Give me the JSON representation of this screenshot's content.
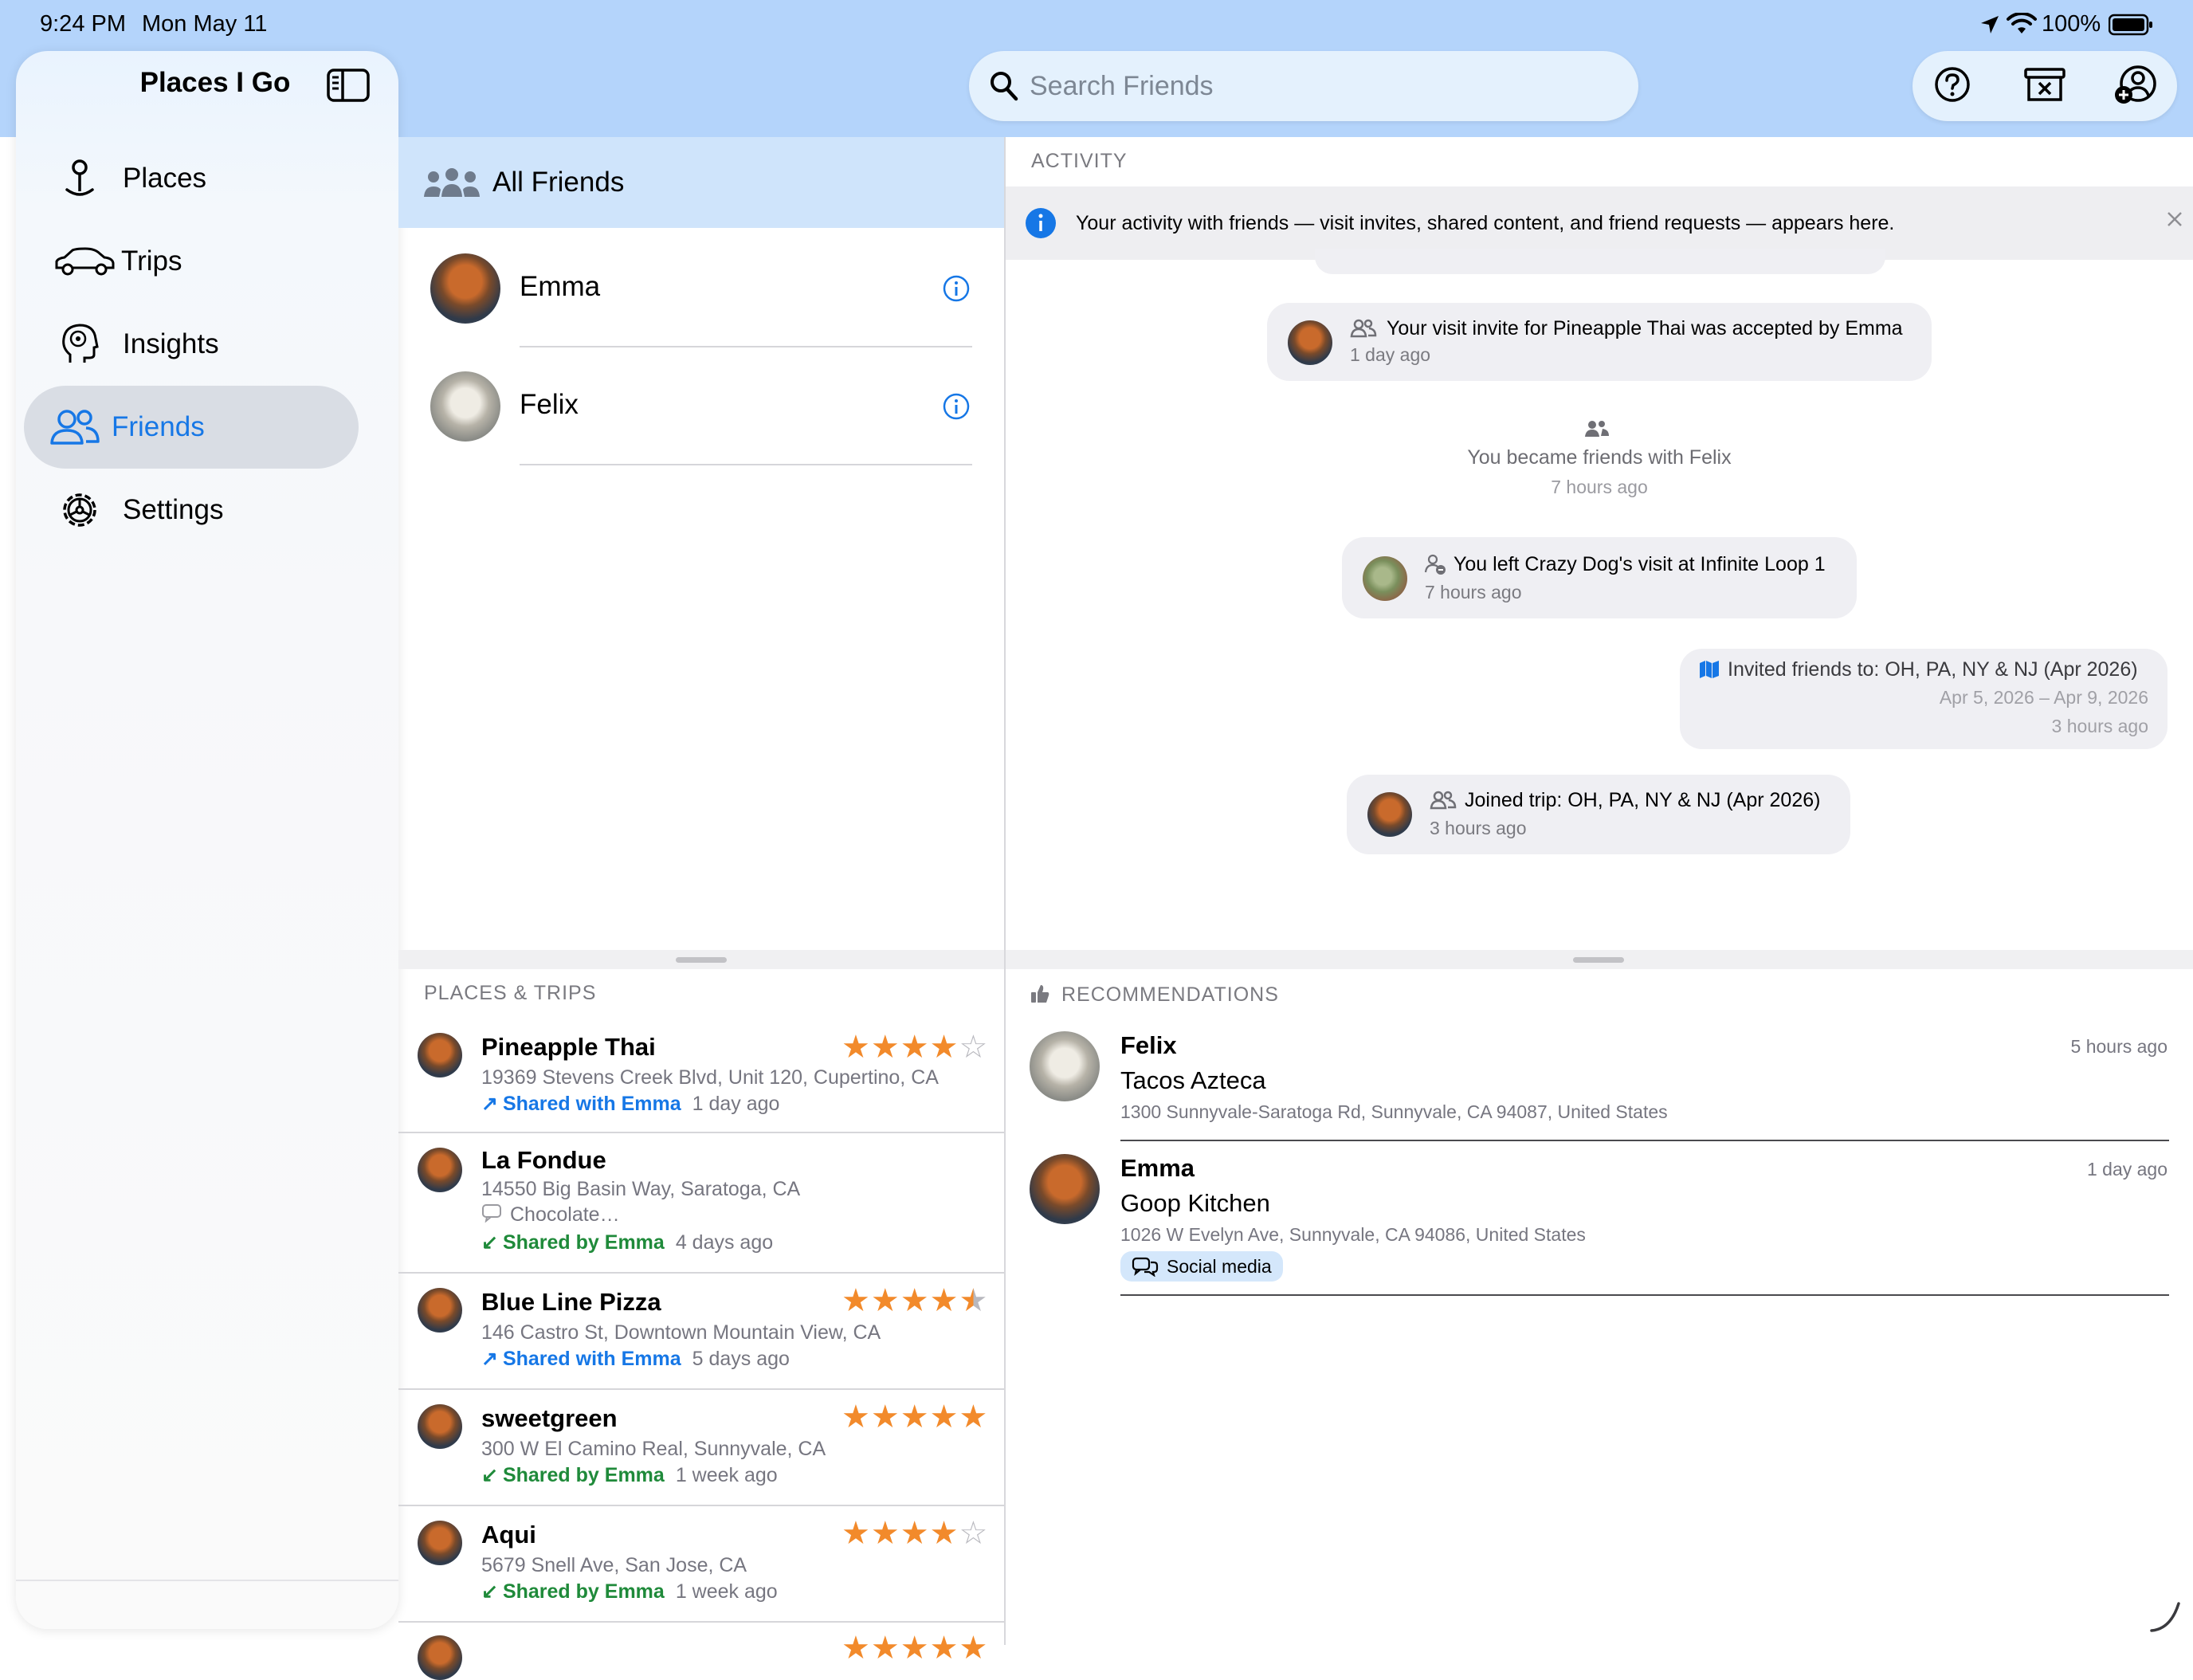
{
  "status_bar": {
    "time": "9:24 PM",
    "date": "Mon May 11",
    "battery": "100%"
  },
  "sidebar": {
    "title": "Places I Go",
    "items": [
      {
        "label": "Places",
        "icon": "pin-icon"
      },
      {
        "label": "Trips",
        "icon": "car-icon"
      },
      {
        "label": "Insights",
        "icon": "brain-head-icon"
      },
      {
        "label": "Friends",
        "icon": "people-icon",
        "selected": true
      },
      {
        "label": "Settings",
        "icon": "gear-icon"
      }
    ]
  },
  "search": {
    "placeholder": "Search Friends"
  },
  "toolbar": {
    "icons": [
      "help-icon",
      "archive-icon",
      "add-friend-icon"
    ]
  },
  "friends": {
    "header": "All Friends",
    "list": [
      {
        "name": "Emma"
      },
      {
        "name": "Felix"
      }
    ]
  },
  "activity": {
    "title": "ACTIVITY",
    "info": "Your activity with friends — visit invites, shared content, and friend requests — appears here.",
    "items": [
      {
        "text": "Your visit invite for Pineapple Thai was accepted by Emma",
        "time": "1 day ago"
      },
      {
        "text": "You became friends with Felix",
        "time": "7 hours ago"
      },
      {
        "text": "You left Crazy Dog's visit at Infinite Loop 1",
        "time": "7 hours ago"
      },
      {
        "text": "Invited friends to: OH, PA, NY & NJ (Apr 2026)",
        "dates": "Apr 5, 2026 – Apr 9, 2026",
        "time": "3 hours ago"
      },
      {
        "text": "Joined trip: OH, PA, NY & NJ (Apr 2026)",
        "time": "3 hours ago"
      }
    ]
  },
  "places_trips": {
    "title": "PLACES & TRIPS",
    "items": [
      {
        "name": "Pineapple Thai",
        "address": "19369 Stevens Creek Blvd, Unit 120, Cupertino, CA",
        "share": "Shared with Emma",
        "direction": "out",
        "time": "1 day ago",
        "rating": 4
      },
      {
        "name": "La Fondue",
        "address": "14550 Big Basin Way, Saratoga, CA",
        "note": "Chocolate…",
        "share": "Shared by Emma",
        "direction": "in",
        "time": "4 days ago",
        "rating": null
      },
      {
        "name": "Blue Line Pizza",
        "address": "146 Castro St, Downtown Mountain View, CA",
        "share": "Shared with Emma",
        "direction": "out",
        "time": "5 days ago",
        "rating": 4.5
      },
      {
        "name": "sweetgreen",
        "address": "300 W El Camino Real, Sunnyvale, CA",
        "share": "Shared by Emma",
        "direction": "in",
        "time": "1 week ago",
        "rating": 5
      },
      {
        "name": "Aqui",
        "address": "5679 Snell Ave, San Jose, CA",
        "share": "Shared by Emma",
        "direction": "in",
        "time": "1 week ago",
        "rating": 4
      }
    ]
  },
  "recommendations": {
    "title": "RECOMMENDATIONS",
    "items": [
      {
        "friend": "Felix",
        "place": "Tacos Azteca",
        "address": "1300 Sunnyvale-Saratoga Rd, Sunnyvale, CA  94087, United States",
        "time": "5 hours ago"
      },
      {
        "friend": "Emma",
        "place": "Goop Kitchen",
        "address": "1026 W Evelyn Ave, Sunnyvale, CA  94086, United States",
        "time": "1 day ago",
        "tag": "Social media"
      }
    ]
  },
  "colors": {
    "accent": "#1677e6",
    "shared_with": "#1677e6",
    "shared_by": "#1f8a3a",
    "star": "#f28a2b",
    "header_band": "#b4d4fb"
  }
}
